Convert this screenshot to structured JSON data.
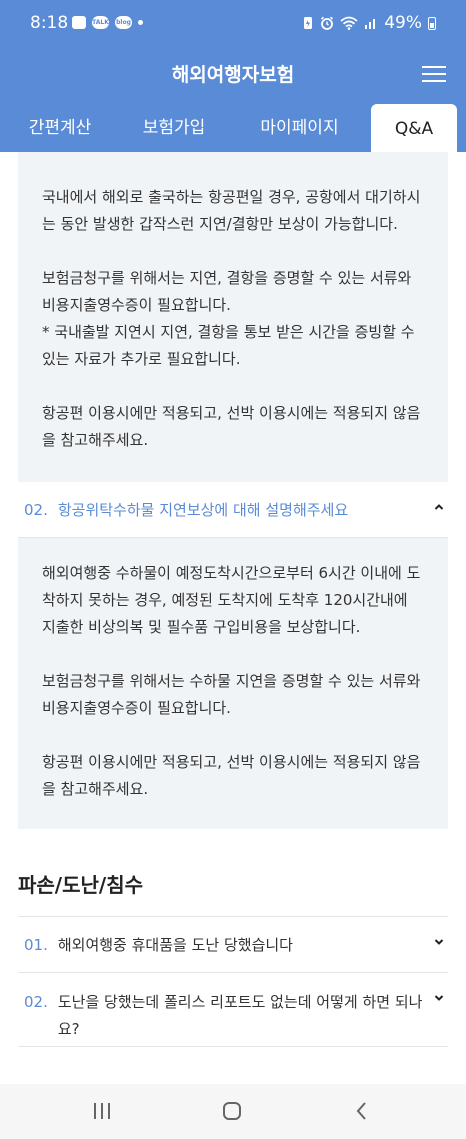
{
  "status": {
    "time": "8:18",
    "left_icons": [
      "image-icon",
      "talk-icon",
      "blog-icon",
      "dot-icon"
    ],
    "talk_text": "TALK",
    "blog_text": "blog",
    "battery": "49%",
    "right_icons": [
      "battery-saver-icon",
      "alarm-icon",
      "wifi-icon",
      "signal-icon",
      "battery-icon"
    ]
  },
  "header": {
    "title": "해외여행자보험",
    "menu_icon": "hamburger-icon"
  },
  "tabs": [
    {
      "label": "간편계산",
      "active": false
    },
    {
      "label": "보험가입",
      "active": false
    },
    {
      "label": "마이페이지",
      "active": false
    },
    {
      "label": "Q&A",
      "active": true
    }
  ],
  "faq": {
    "answer1": {
      "paragraphs": [
        "국내에서 해외로 출국하는 항공편일 경우, 공항에서 대기하시는 동안 발생한 갑작스런 지연/결항만 보상이 가능합니다.",
        "보험금청구를 위해서는 지연, 결항을 증명할 수 있는 서류와 비용지출영수증이 필요합니다.\n* 국내출발 지연시 지연, 결항을 통보 받은 시간을 증빙할 수 있는 자료가 추가로 필요합니다.",
        "항공편 이용시에만 적용되고, 선박 이용시에는 적용되지 않음을 참고해주세요."
      ]
    },
    "question2": {
      "num": "02.",
      "text": "항공위탁수하물 지연보상에 대해 설명해주세요",
      "icon": "chevron-up-icon"
    },
    "answer2": {
      "paragraphs": [
        "해외여행중 수하물이 예정도착시간으로부터 6시간 이내에 도착하지 못하는 경우, 예정된 도착지에 도착후 120시간내에 지출한 비상의복 및 필수품 구입비용을 보상합니다.",
        "보험금청구를 위해서는 수하물 지연을 증명할 수 있는 서류와 비용지출영수증이 필요합니다.",
        "항공편 이용시에만 적용되고, 선박 이용시에는 적용되지 않음을 참고해주세요."
      ]
    },
    "section": {
      "title": "파손/도난/침수"
    },
    "section_questions": [
      {
        "num": "01.",
        "text": "해외여행중 휴대품을 도난 당했습니다",
        "icon": "chevron-down-icon"
      },
      {
        "num": "02.",
        "text": "도난을 당했는데 폴리스 리포트도 없는데 어떻게 하면 되나요?",
        "icon": "chevron-down-icon"
      }
    ]
  },
  "navbar": {
    "icons": [
      "recent-apps-icon",
      "home-icon",
      "back-icon"
    ]
  },
  "colors": {
    "primary": "#5a8bd6",
    "answer_bg": "#f1f4f7"
  }
}
